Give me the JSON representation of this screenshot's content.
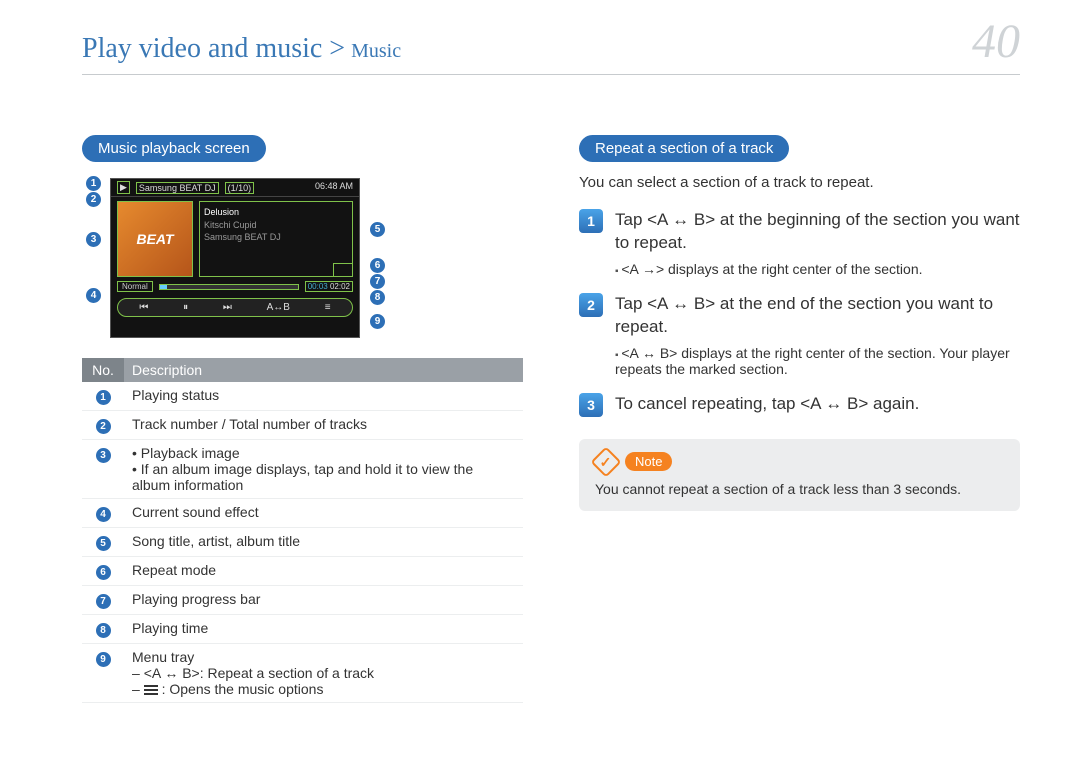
{
  "header": {
    "breadcrumb_main": "Play video and music >",
    "breadcrumb_sub": "Music",
    "page_number": "40"
  },
  "left": {
    "section_title": "Music playback screen",
    "screenshot": {
      "album_text": "BEAT",
      "topbar_title": "Samsung BEAT DJ",
      "track_counter": "(1/10)",
      "clock": "06:48 AM",
      "tracks": [
        "Delusion",
        "Kitschi Cupid",
        "Samsung BEAT DJ"
      ],
      "sound_mode": "Normal",
      "time_elapsed": "00:03",
      "time_total": "02:02",
      "menu_items": [
        "⏮",
        "⏸",
        "⏭",
        "A↔B",
        "≡"
      ]
    },
    "table": {
      "head_no": "No.",
      "head_desc": "Description",
      "rows": [
        {
          "n": "1",
          "d": "Playing status"
        },
        {
          "n": "2",
          "d": "Track number / Total number of tracks"
        },
        {
          "n": "3",
          "d_list": [
            "Playback image",
            "If an album image displays, tap and hold it to view the album information"
          ]
        },
        {
          "n": "4",
          "d": "Current sound effect"
        },
        {
          "n": "5",
          "d": "Song title, artist, album title"
        },
        {
          "n": "6",
          "d": "Repeat mode"
        },
        {
          "n": "7",
          "d": "Playing progress bar"
        },
        {
          "n": "8",
          "d": "Playing time"
        },
        {
          "n": "9",
          "d_pre": "Menu tray",
          "d_dash": [
            "<A ↔ B>: Repeat a section of a track",
            "    : Opens the music options"
          ]
        }
      ]
    }
  },
  "right": {
    "section_title": "Repeat a section of a track",
    "intro": "You can select a section of a track to repeat.",
    "steps": [
      {
        "n": "1",
        "t": "Tap <A ↔ B> at the beginning of the section you want to repeat.",
        "sub": [
          "<A →> displays at the right center of the section."
        ]
      },
      {
        "n": "2",
        "t": "Tap <A ↔ B> at the end of the section you want to repeat.",
        "sub": [
          "<A ↔ B> displays at the right center of the section. Your player repeats the marked section."
        ]
      },
      {
        "n": "3",
        "t": "To cancel repeating, tap <A ↔ B> again."
      }
    ],
    "note": {
      "label": "Note",
      "text": "You cannot repeat a section of a track less than 3 seconds."
    }
  }
}
